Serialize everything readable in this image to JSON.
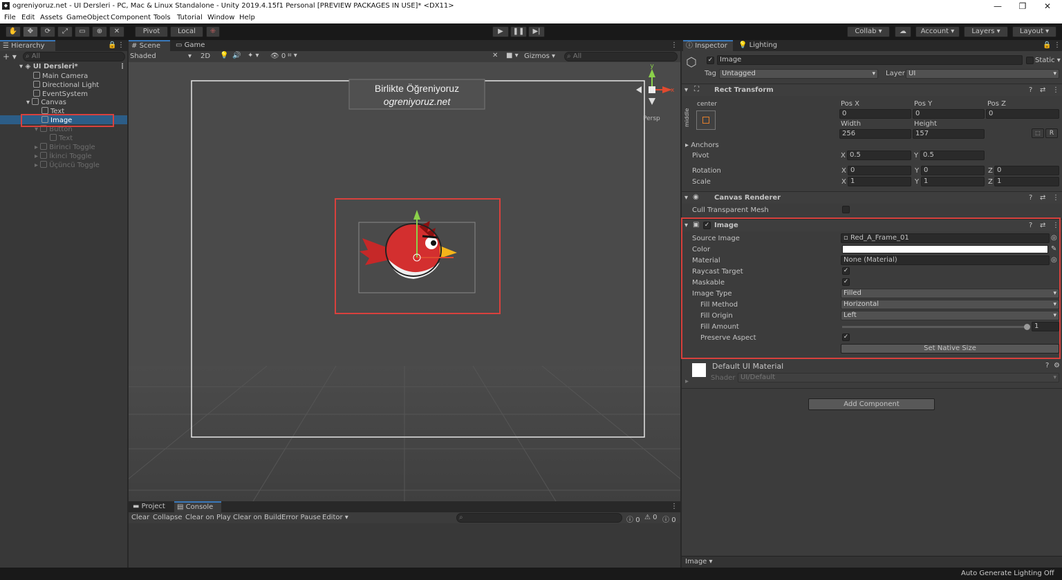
{
  "window": {
    "title": "ogreniyoruz.net - UI Dersleri - PC, Mac & Linux Standalone - Unity 2019.4.15f1 Personal [PREVIEW PACKAGES IN USE]* <DX11>",
    "minimize": "—",
    "restore": "❐",
    "close": "✕"
  },
  "menu": [
    "File",
    "Edit",
    "Assets",
    "GameObject",
    "Component",
    "Tools",
    "Tutorial",
    "Window",
    "Help"
  ],
  "toolbar": {
    "pivot": "Pivot",
    "local": "Local",
    "collab": "Collab",
    "account": "Account",
    "layers": "Layers",
    "layout": "Layout"
  },
  "hierarchy": {
    "tab": "Hierarchy",
    "search_placeholder": "All",
    "items": [
      {
        "label": "UI Dersleri*",
        "state": "scene"
      },
      {
        "label": "Main Camera",
        "state": "normal"
      },
      {
        "label": "Directional Light",
        "state": "normal"
      },
      {
        "label": "EventSystem",
        "state": "normal"
      },
      {
        "label": "Canvas",
        "state": "normal"
      },
      {
        "label": "Text",
        "state": "normal"
      },
      {
        "label": "Image",
        "state": "selected"
      },
      {
        "label": "Button",
        "state": "disabled"
      },
      {
        "label": "Text",
        "state": "disabled"
      },
      {
        "label": "Birinci Toggle",
        "state": "disabled"
      },
      {
        "label": "İkinci Toggle",
        "state": "disabled"
      },
      {
        "label": "Üçüncü Toggle",
        "state": "disabled"
      }
    ]
  },
  "scene": {
    "tab_scene": "Scene",
    "tab_game": "Game",
    "shading": "Shaded",
    "mode_2d": "2D",
    "fx_count": "0",
    "gizmos": "Gizmos",
    "search_placeholder": "All",
    "persp": "Persp",
    "watermark_line1": "Birlikte Öğreniyoruz",
    "watermark_line2": "ogreniyoruz.net",
    "gizmo_y": "y",
    "gizmo_x": "x"
  },
  "console": {
    "tab_project": "Project",
    "tab_console": "Console",
    "clear": "Clear",
    "collapse": "Collapse",
    "clear_on_play": "Clear on Play",
    "clear_on_build": "Clear on Build",
    "error_pause": "Error Pause",
    "editor": "Editor",
    "info_count": "0",
    "warn_count": "0",
    "error_count": "0"
  },
  "inspector": {
    "tab_inspector": "Inspector",
    "tab_lighting": "Lighting",
    "object_name": "Image",
    "static_label": "Static",
    "tag_label": "Tag",
    "tag_value": "Untagged",
    "layer_label": "Layer",
    "layer_value": "UI",
    "rect_transform": {
      "title": "Rect Transform",
      "anchor_h": "center",
      "anchor_v": "middle",
      "posx_label": "Pos X",
      "posy_label": "Pos Y",
      "posz_label": "Pos Z",
      "posx": "0",
      "posy": "0",
      "posz": "0",
      "width_label": "Width",
      "height_label": "Height",
      "width": "256",
      "height": "157",
      "r_btn": "R",
      "anchors_label": "Anchors",
      "pivot_label": "Pivot",
      "pivot_x": "0.5",
      "pivot_y": "0.5",
      "rotation_label": "Rotation",
      "rot_x": "0",
      "rot_y": "0",
      "rot_z": "0",
      "scale_label": "Scale",
      "scale_x": "1",
      "scale_y": "1",
      "scale_z": "1",
      "x": "X",
      "y": "Y",
      "z": "Z"
    },
    "canvas_renderer": {
      "title": "Canvas Renderer",
      "cull_label": "Cull Transparent Mesh"
    },
    "image": {
      "title": "Image",
      "source_image_label": "Source Image",
      "source_image": "Red_A_Frame_01",
      "color_label": "Color",
      "color_value": "#ffffff",
      "material_label": "Material",
      "material": "None (Material)",
      "raycast_label": "Raycast Target",
      "maskable_label": "Maskable",
      "image_type_label": "Image Type",
      "image_type": "Filled",
      "fill_method_label": "Fill Method",
      "fill_method": "Horizontal",
      "fill_origin_label": "Fill Origin",
      "fill_origin": "Left",
      "fill_amount_label": "Fill Amount",
      "fill_amount": "1",
      "preserve_label": "Preserve Aspect",
      "native_size_button": "Set Native Size"
    },
    "material": {
      "name": "Default UI Material",
      "shader_label": "Shader",
      "shader": "UI/Default"
    },
    "add_component": "Add Component",
    "preview_label": "Image"
  },
  "status": {
    "lighting": "Auto Generate Lighting Off"
  }
}
